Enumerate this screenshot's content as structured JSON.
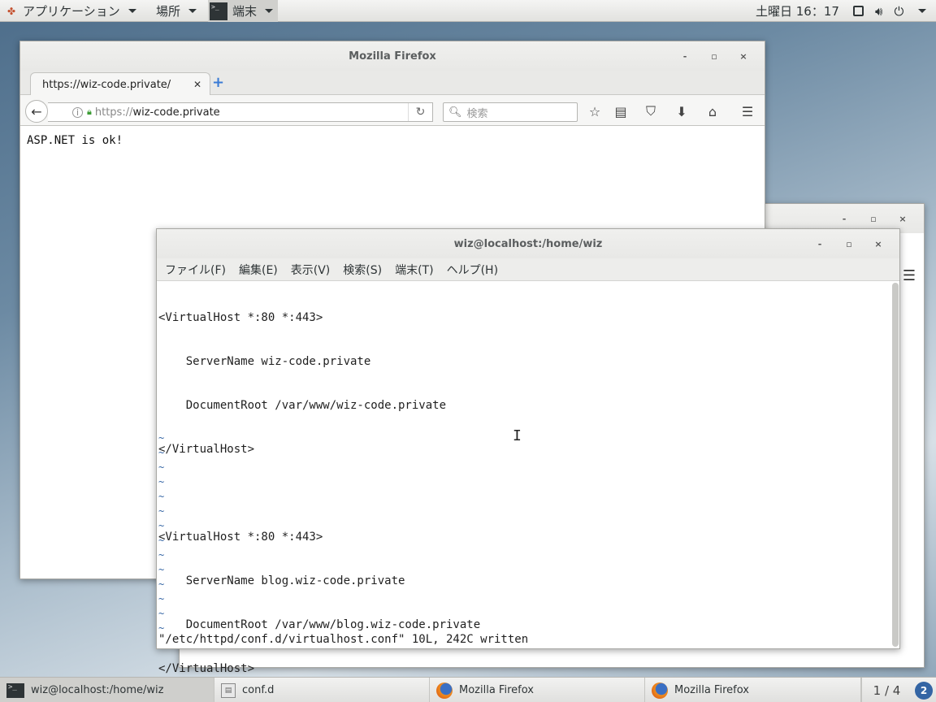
{
  "top_panel": {
    "applications_label": "アプリケーション",
    "places_label": "場所",
    "terminal_app_label": "端末",
    "clock": "土曜日 16：17"
  },
  "firefox_back": {
    "minimize": "-",
    "maximize": "▫",
    "close": "×"
  },
  "firefox": {
    "window_title": "Mozilla Firefox",
    "minimize": "-",
    "maximize": "▫",
    "close": "×",
    "tab_title": "https://wiz-code.private/",
    "url_proto": "https://",
    "url_host": "wiz-code.private",
    "search_placeholder": "検索",
    "page_text": "ASP.NET is ok!"
  },
  "terminal": {
    "window_title": "wiz@localhost:/home/wiz",
    "minimize": "-",
    "maximize": "▫",
    "close": "×",
    "menu": [
      "ファイル(F)",
      "編集(E)",
      "表示(V)",
      "検索(S)",
      "端末(T)",
      "ヘルプ(H)"
    ],
    "lines": [
      "<VirtualHost *:80 *:443>",
      "    ServerName wiz-code.private",
      "    DocumentRoot /var/www/wiz-code.private",
      "</VirtualHost>",
      "",
      "<VirtualHost *:80 *:443>",
      "    ServerName blog.wiz-code.private",
      "    DocumentRoot /var/www/blog.wiz-code.private",
      "</VirtualHost>"
    ],
    "tilde": "~",
    "status_line": "\"/etc/httpd/conf.d/virtualhost.conf\" 10L, 242C written"
  },
  "taskbar": {
    "items": [
      {
        "label": "wiz@localhost:/home/wiz"
      },
      {
        "label": "conf.d"
      },
      {
        "label": "Mozilla Firefox"
      },
      {
        "label": "Mozilla Firefox"
      }
    ],
    "workspace": "1 / 4",
    "help_badge": "2"
  }
}
